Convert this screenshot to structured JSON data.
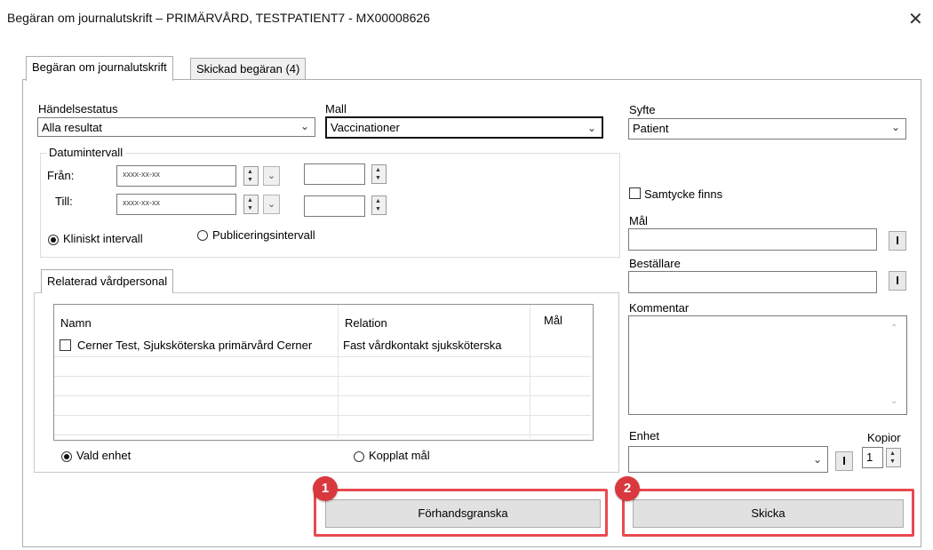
{
  "window": {
    "title": "Begäran om journalutskrift – PRIMÄRVÅRD, TESTPATIENT7 - MX00008626",
    "close_glyph": "✕"
  },
  "tabs": [
    {
      "label": "Begäran om journalutskrift",
      "active": true
    },
    {
      "label": "Skickad begäran (4)",
      "active": false
    }
  ],
  "status": {
    "label": "Händelsestatus",
    "value": "Alla resultat"
  },
  "template": {
    "label": "Mall",
    "value": "Vaccinationer"
  },
  "purpose": {
    "label": "Syfte",
    "value": "Patient"
  },
  "date_range": {
    "group_label": "Datumintervall",
    "from_label": "Från:",
    "to_label": "Till:",
    "from_date": "xxxx-xx-xx",
    "to_date": "xxxx-xx-xx",
    "from_time": "",
    "to_time": ""
  },
  "interval": {
    "clinical": "Kliniskt intervall",
    "published": "Publiceringsintervall",
    "selected": "clinical"
  },
  "consent": {
    "label": "Samtycke finns",
    "checked": false
  },
  "goal": {
    "label": "Mål",
    "value": "",
    "button": "I"
  },
  "orderer": {
    "label": "Beställare",
    "value": "",
    "button": "I"
  },
  "comment": {
    "label": "Kommentar",
    "value": ""
  },
  "unit": {
    "label": "Enhet",
    "value": "",
    "button": "I"
  },
  "copies": {
    "label": "Kopior",
    "value": "1"
  },
  "personnel": {
    "tab_label": "Relaterad vårdpersonal",
    "columns": [
      "Namn",
      "Relation",
      "Mål"
    ],
    "rows": [
      {
        "name": "Cerner Test, Sjuksköterska primärvård Cerner",
        "relation": "Fast vårdkontakt sjuksköterska",
        "goal": "",
        "checked": false
      }
    ]
  },
  "scope": {
    "selected_unit": "Vald enhet",
    "linked_goal": "Kopplat mål",
    "selected": "selected_unit"
  },
  "actions": {
    "preview": "Förhandsgranska",
    "send": "Skicka"
  },
  "callouts": {
    "preview": "1",
    "send": "2"
  },
  "colors": {
    "callout": "#d9393e",
    "highlight": "#e84a50"
  },
  "icons": [
    "close-icon",
    "chevron-down-icon",
    "spin-up-icon",
    "spin-down-icon",
    "radio-icon",
    "checkbox-icon",
    "scroll-up-icon",
    "scroll-down-icon"
  ]
}
